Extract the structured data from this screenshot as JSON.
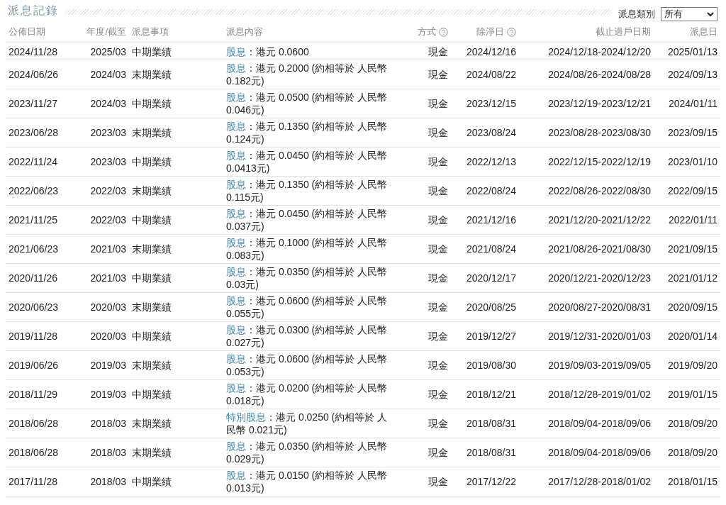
{
  "section": {
    "title": "派息記錄",
    "filter_label": "派息類別",
    "filter_value": "所有"
  },
  "table": {
    "columns": [
      {
        "label": "公佈日期",
        "help": false
      },
      {
        "label": "年度/截至",
        "help": false
      },
      {
        "label": "派息事項",
        "help": false
      },
      {
        "label": "派息內容",
        "help": false
      },
      {
        "label": "方式",
        "help": true
      },
      {
        "label": "除淨日",
        "help": true
      },
      {
        "label": "截止過戶日期",
        "help": false
      },
      {
        "label": "派息日",
        "help": false
      }
    ],
    "rows": [
      {
        "announced": "2024/11/28",
        "year_end": "2025/03",
        "item": "中期業績",
        "type": "股息",
        "detail": "：港元 0.0600",
        "method": "現金",
        "ex_date": "2024/12/16",
        "book_close": "2024/12/18-2024/12/20",
        "pay_date": "2025/01/13"
      },
      {
        "announced": "2024/06/26",
        "year_end": "2024/03",
        "item": "末期業績",
        "type": "股息",
        "detail": "：港元 0.2000 (約相等於 人民幣 0.182元)",
        "method": "現金",
        "ex_date": "2024/08/22",
        "book_close": "2024/08/26-2024/08/28",
        "pay_date": "2024/09/13"
      },
      {
        "announced": "2023/11/27",
        "year_end": "2024/03",
        "item": "中期業績",
        "type": "股息",
        "detail": "：港元 0.0500 (約相等於 人民幣 0.046元)",
        "method": "現金",
        "ex_date": "2023/12/15",
        "book_close": "2023/12/19-2023/12/21",
        "pay_date": "2024/01/11"
      },
      {
        "announced": "2023/06/28",
        "year_end": "2023/03",
        "item": "末期業績",
        "type": "股息",
        "detail": "：港元 0.1350 (約相等於 人民幣 0.124元)",
        "method": "現金",
        "ex_date": "2023/08/24",
        "book_close": "2023/08/28-2023/08/30",
        "pay_date": "2023/09/15"
      },
      {
        "announced": "2022/11/24",
        "year_end": "2023/03",
        "item": "中期業績",
        "type": "股息",
        "detail": "：港元 0.0450 (約相等於 人民幣 0.0413元)",
        "method": "現金",
        "ex_date": "2022/12/13",
        "book_close": "2022/12/15-2022/12/19",
        "pay_date": "2023/01/10"
      },
      {
        "announced": "2022/06/23",
        "year_end": "2022/03",
        "item": "末期業績",
        "type": "股息",
        "detail": "：港元 0.1350 (約相等於 人民幣 0.115元)",
        "method": "現金",
        "ex_date": "2022/08/24",
        "book_close": "2022/08/26-2022/08/30",
        "pay_date": "2022/09/15"
      },
      {
        "announced": "2021/11/25",
        "year_end": "2022/03",
        "item": "中期業績",
        "type": "股息",
        "detail": "：港元 0.0450 (約相等於 人民幣 0.037元)",
        "method": "現金",
        "ex_date": "2021/12/16",
        "book_close": "2021/12/20-2021/12/22",
        "pay_date": "2022/01/11"
      },
      {
        "announced": "2021/06/23",
        "year_end": "2021/03",
        "item": "末期業績",
        "type": "股息",
        "detail": "：港元 0.1000 (約相等於 人民幣 0.083元)",
        "method": "現金",
        "ex_date": "2021/08/24",
        "book_close": "2021/08/26-2021/08/30",
        "pay_date": "2021/09/15"
      },
      {
        "announced": "2020/11/26",
        "year_end": "2021/03",
        "item": "中期業績",
        "type": "股息",
        "detail": "：港元 0.0350 (約相等於 人民幣 0.03元)",
        "method": "現金",
        "ex_date": "2020/12/17",
        "book_close": "2020/12/21-2020/12/23",
        "pay_date": "2021/01/12"
      },
      {
        "announced": "2020/06/23",
        "year_end": "2020/03",
        "item": "末期業績",
        "type": "股息",
        "detail": "：港元 0.0600 (約相等於 人民幣 0.055元)",
        "method": "現金",
        "ex_date": "2020/08/25",
        "book_close": "2020/08/27-2020/08/31",
        "pay_date": "2020/09/15"
      },
      {
        "announced": "2019/11/28",
        "year_end": "2020/03",
        "item": "中期業績",
        "type": "股息",
        "detail": "：港元 0.0300 (約相等於 人民幣 0.027元)",
        "method": "現金",
        "ex_date": "2019/12/27",
        "book_close": "2019/12/31-2020/01/03",
        "pay_date": "2020/01/14"
      },
      {
        "announced": "2019/06/26",
        "year_end": "2019/03",
        "item": "末期業績",
        "type": "股息",
        "detail": "：港元 0.0600 (約相等於 人民幣 0.053元)",
        "method": "現金",
        "ex_date": "2019/08/30",
        "book_close": "2019/09/03-2019/09/05",
        "pay_date": "2019/09/20"
      },
      {
        "announced": "2018/11/29",
        "year_end": "2019/03",
        "item": "中期業績",
        "type": "股息",
        "detail": "：港元 0.0200 (約相等於 人民幣 0.018元)",
        "method": "現金",
        "ex_date": "2018/12/21",
        "book_close": "2018/12/28-2019/01/02",
        "pay_date": "2019/01/15"
      },
      {
        "announced": "2018/06/28",
        "year_end": "2018/03",
        "item": "末期業績",
        "type": "特別股息",
        "detail": "：港元 0.0250 (約相等於 人民幣 0.021元)",
        "method": "現金",
        "ex_date": "2018/08/31",
        "book_close": "2018/09/04-2018/09/06",
        "pay_date": "2018/09/20"
      },
      {
        "announced": "2018/06/28",
        "year_end": "2018/03",
        "item": "末期業績",
        "type": "股息",
        "detail": "：港元 0.0350 (約相等於 人民幣 0.029元)",
        "method": "現金",
        "ex_date": "2018/08/31",
        "book_close": "2018/09/04-2018/09/06",
        "pay_date": "2018/09/20"
      },
      {
        "announced": "2017/11/28",
        "year_end": "2018/03",
        "item": "中期業績",
        "type": "股息",
        "detail": "：港元 0.0150 (約相等於 人民幣 0.013元)",
        "method": "現金",
        "ex_date": "2017/12/22",
        "book_close": "2017/12/28-2018/01/02",
        "pay_date": "2018/01/15"
      }
    ]
  }
}
